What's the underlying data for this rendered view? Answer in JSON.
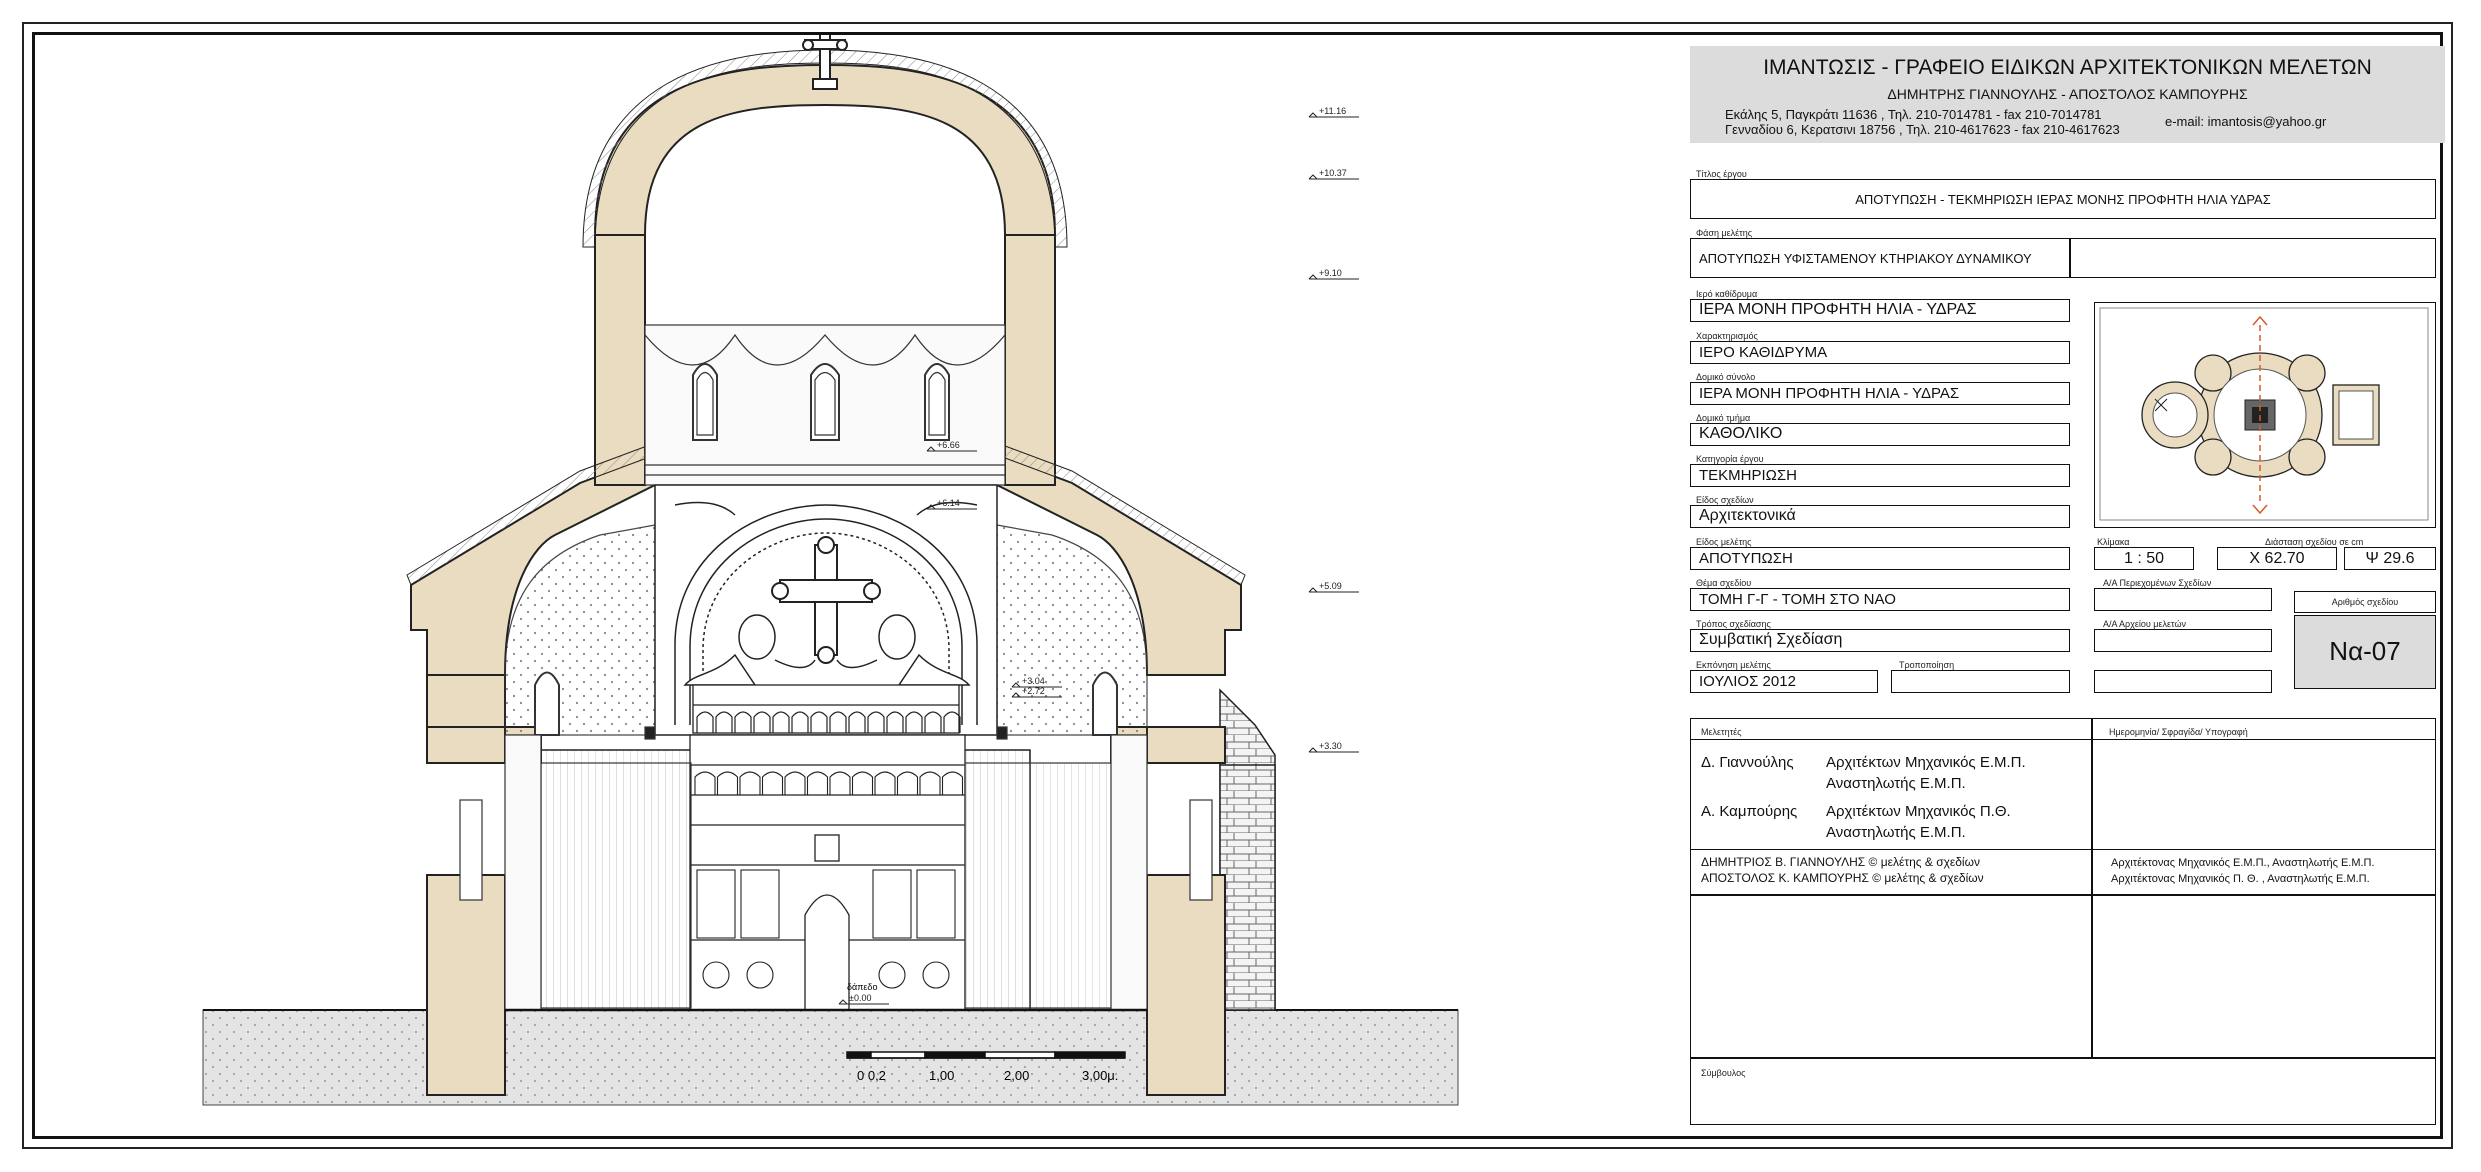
{
  "office": {
    "name": "ΙΜΑΝΤΩΣΙΣ - ΓΡΑΦΕΙΟ ΕΙΔΙΚΩΝ ΑΡΧΙΤΕΚΤΟΝΙΚΩΝ ΜΕΛΕΤΩΝ",
    "partners": "ΔΗΜΗΤΡΗΣ ΓΙΑΝΝΟΥΛΗΣ  -  ΑΠΟΣΤΟΛΟΣ ΚΑΜΠΟΥΡΗΣ",
    "address1": "Εκάλης 5, Παγκράτι 11636 , Τηλ. 210-7014781 - fax 210-7014781",
    "address2": "Γενναδίου 6, Κερατσινι 18756 , Τηλ. 210-4617623 - fax 210-4617623",
    "email": "e-mail: imantosis@yahoo.gr"
  },
  "fields": {
    "project_title_label": "Τίτλος έργου",
    "project_title": "ΑΠΟΤΥΠΩΣΗ - ΤΕΚΜΗΡΙΩΣΗ ΙΕΡΑΣ ΜΟΝΗΣ ΠΡΟΦΗΤΗ ΗΛΙΑ ΥΔΡΑΣ",
    "phase_label": "Φάση μελέτης",
    "phase": "ΑΠΟΤΥΠΩΣΗ ΥΦΙΣΤΑΜΕΝΟΥ ΚΤΗΡΙΑΚΟΥ ΔΥΝΑΜΙΚΟΥ",
    "foundation_label": "Ιερό καθίδρυμα",
    "foundation": "ΙΕΡΑ ΜΟΝΗ ΠΡΟΦΗΤΗ ΗΛΙΑ - ΥΔΡΑΣ",
    "character_label": "Χαρακτηρισμός",
    "character": "ΙΕΡΟ ΚΑΘΙΔΡΥΜΑ",
    "complex_label": "Δομικό σύνολο",
    "complex": "ΙΕΡΑ ΜΟΝΗ ΠΡΟΦΗΤΗ ΗΛΙΑ - ΥΔΡΑΣ",
    "part_label": "Δομικό τμήμα",
    "part": "ΚΑΘΟΛΙΚΟ",
    "category_label": "Κατηγορία έργου",
    "category": "ΤΕΚΜΗΡΙΩΣΗ",
    "drawing_type_label": "Είδος σχεδίων",
    "drawing_type": "Αρχιτεκτονικά",
    "study_type_label": "Είδος μελέτης",
    "study_type": "ΑΠΟΤΥΠΩΣΗ",
    "subject_label": "Θέμα σχεδίου",
    "subject": "ΤΟΜΗ Γ-Γ  -  ΤΟΜΗ ΣΤΟ ΝΑΟ",
    "method_label": "Τρόπος σχεδίασης",
    "method": "Συμβατική Σχεδίαση",
    "date_label": "Εκπόνηση μελέτης",
    "date": "ΙΟΥΛΙΟΣ  2012",
    "revision_label": "Τροποποίηση",
    "scale_label": "Κλίμακα",
    "scale": "1 : 50",
    "sheet_dim_label": "Διάσταση σχεδίου σε cm",
    "dim_x": "X  62.70",
    "dim_y": "Ψ  29.6",
    "included_label": "Α/Α Περιεχομένων Σχεδίων",
    "archive_label": "Α/Α Αρχείου μελετών",
    "drawing_no_label": "Αριθμός σχεδίου",
    "drawing_no": "Να-07"
  },
  "designers": {
    "label": "Μελετητές",
    "sign_label": "Ημερομηνία/ Σφραγίδα/ Υπογραφή",
    "d1_name": "Δ. Γιαννούλης",
    "d1_role1": "Αρχιτέκτων Μηχανικός Ε.Μ.Π.",
    "d1_role2": "Αναστηλωτής Ε.Μ.Π.",
    "d2_name": "Α. Καμπούρης",
    "d2_role1": "Αρχιτέκτων Μηχανικός Π.Θ.",
    "d2_role2": "Αναστηλωτής Ε.Μ.Π.",
    "c1": "ΔΗΜΗΤΡΙΟΣ Β. ΓΙΑΝΝΟΥΛΗΣ  © μελέτης & σχεδίων",
    "c2": "ΑΠΟΣΤΟΛΟΣ Κ. ΚΑΜΠΟΥΡΗΣ  © μελέτης & σχεδίων",
    "c1_role": "Αρχιτέκτονας Μηχανικός Ε.Μ.Π., Αναστηλωτής Ε.Μ.Π.",
    "c2_role": "Αρχιτέκτονας Μηχανικός Π. Θ. ,  Αναστηλωτής Ε.Μ.Π.",
    "advisor_label": "Σύμβουλος"
  },
  "drawing": {
    "elevations": [
      "+11.16",
      "+10.37",
      "+9.10",
      "+6.66",
      "+6.14",
      "+5.09",
      "+3.04",
      "+2.72",
      "+3.30",
      "±0.00"
    ],
    "floor_note": "δάπεδο",
    "scale_bar": [
      "0 0,2",
      "1,00",
      "2,00",
      "3,00μ."
    ]
  },
  "colors": {
    "wall_fill": "#e9dcc0",
    "ground_fill": "#e4e4e4",
    "line": "#222222"
  }
}
